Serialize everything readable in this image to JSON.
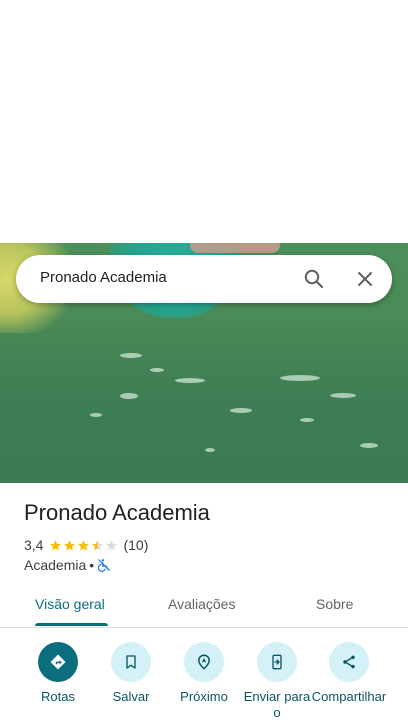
{
  "search": {
    "query": "Pronado Academia"
  },
  "place": {
    "name": "Pronado Academia",
    "rating": "3,4",
    "rating_value": 3.4,
    "review_count": "(10)",
    "category": "Academia",
    "separator": "•"
  },
  "tabs": [
    {
      "label": "Visão geral",
      "active": true
    },
    {
      "label": "Avaliações",
      "active": false
    },
    {
      "label": "Sobre",
      "active": false
    }
  ],
  "actions": [
    {
      "label": "Rotas",
      "icon": "directions-icon"
    },
    {
      "label": "Salvar",
      "icon": "bookmark-icon"
    },
    {
      "label": "Próximo",
      "icon": "nearby-icon"
    },
    {
      "label": "Enviar para o",
      "icon": "send-to-phone-icon"
    },
    {
      "label": "Compartilhar",
      "icon": "share-icon"
    }
  ],
  "colors": {
    "accent": "#0b6e7e",
    "star": "#fbbc04",
    "icon_bg": "#d3f1f7"
  }
}
